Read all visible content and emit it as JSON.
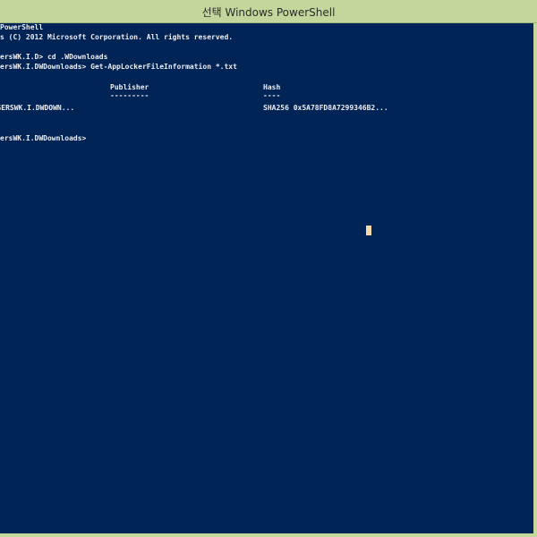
{
  "window": {
    "title": "선택 Windows PowerShell"
  },
  "console": {
    "lines": {
      "banner_title": "PowerShell",
      "copyright": "s (C) 2012 Microsoft Corporation. All rights reserved.",
      "prompt_cd": "ersWK.I.D> cd .WDownloads",
      "prompt_cmd": "ersWK.I.DWDownloads> Get-AppLockerFileInformation *.txt",
      "header_publisher": "Publisher",
      "header_hash": "Hash",
      "sep_publisher": "---------",
      "sep_hash": "----",
      "row_path": "\\WUSERSWK.I.DWDOWN...",
      "row_hash": "SHA256 0x5A78FD8A7299346B2...",
      "prompt_final": "ersWK.I.DWDownloads>"
    }
  },
  "colors": {
    "console_background": "#012456",
    "console_text": "#eeedf0",
    "titlebar": "#c3d69b",
    "cursor": "#f6d9a8"
  }
}
